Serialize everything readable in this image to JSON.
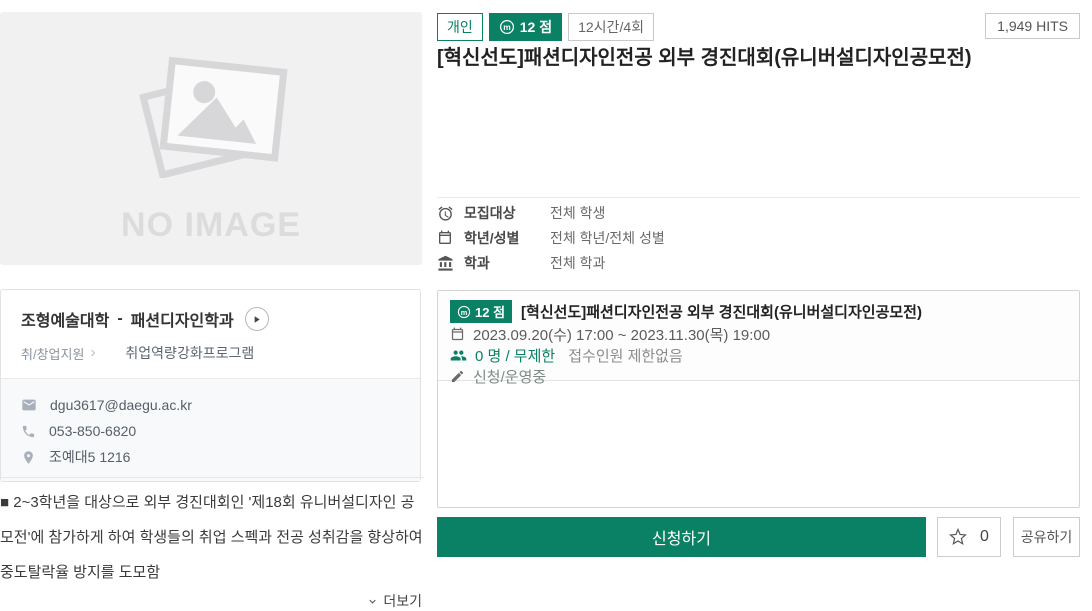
{
  "accent_color": "#0a8164",
  "placeholder": {
    "no_image_label": "NO IMAGE"
  },
  "header": {
    "badges": [
      {
        "label": "개인"
      },
      {
        "label": "12 점",
        "icon": "circled-m"
      },
      {
        "label": "12시간/4회"
      }
    ],
    "hits": "1,949 HITS",
    "title": "[혁신선도]패션디자인전공 외부 경진대회(유니버설디자인공모전)"
  },
  "summary": {
    "rows": [
      {
        "icon": "alarm-clock",
        "label": "모집대상",
        "value": "전체 학생"
      },
      {
        "icon": "calendar",
        "label": "학년/성별",
        "value": "전체 학년/전체 성별"
      },
      {
        "icon": "bank",
        "label": "학과",
        "value": "전체 학과"
      }
    ]
  },
  "organizer": {
    "college": "조형예술대학",
    "separator": "-",
    "department": "패션디자인학과",
    "category_path": "취/창업지원",
    "program_type": "취업역량강화프로그램",
    "email": "dgu3617@daegu.ac.kr",
    "phone": "053-850-6820",
    "location": "조예대5 1216"
  },
  "description": {
    "text": "■ 2~3학년을 대상으로 외부 경진대회인 '제18회 유니버설디자인 공모전'에 참가하게 하여 학생들의 취업 스펙과 전공 성취감을 향상하여 중도탈락율 방지를 도모함",
    "more_label": "더보기"
  },
  "session": {
    "points_badge": "12 점",
    "title": "[혁신선도]패션디자인전공 외부 경진대회(유니버설디자인공모전)",
    "period": "2023.09.20(수) 17:00 ~ 2023.11.30(목) 19:00",
    "capacity_highlight": "0 명 / 무제한",
    "capacity_note": "접수인원 제한없음",
    "status": "신청/운영중"
  },
  "actions": {
    "apply_label": "신청하기",
    "favorite_count": "0",
    "share_label": "공유하기"
  },
  "icons": {
    "points": "circled-m",
    "recruit_target": "alarm-clock",
    "grade_gender": "calendar",
    "department": "bank",
    "email": "envelope",
    "phone": "phone-receiver",
    "location": "map-pin",
    "period": "calendar",
    "capacity": "people",
    "status": "pen",
    "favorite": "star-outline",
    "more": "chevron-down",
    "play": "play-triangle"
  }
}
